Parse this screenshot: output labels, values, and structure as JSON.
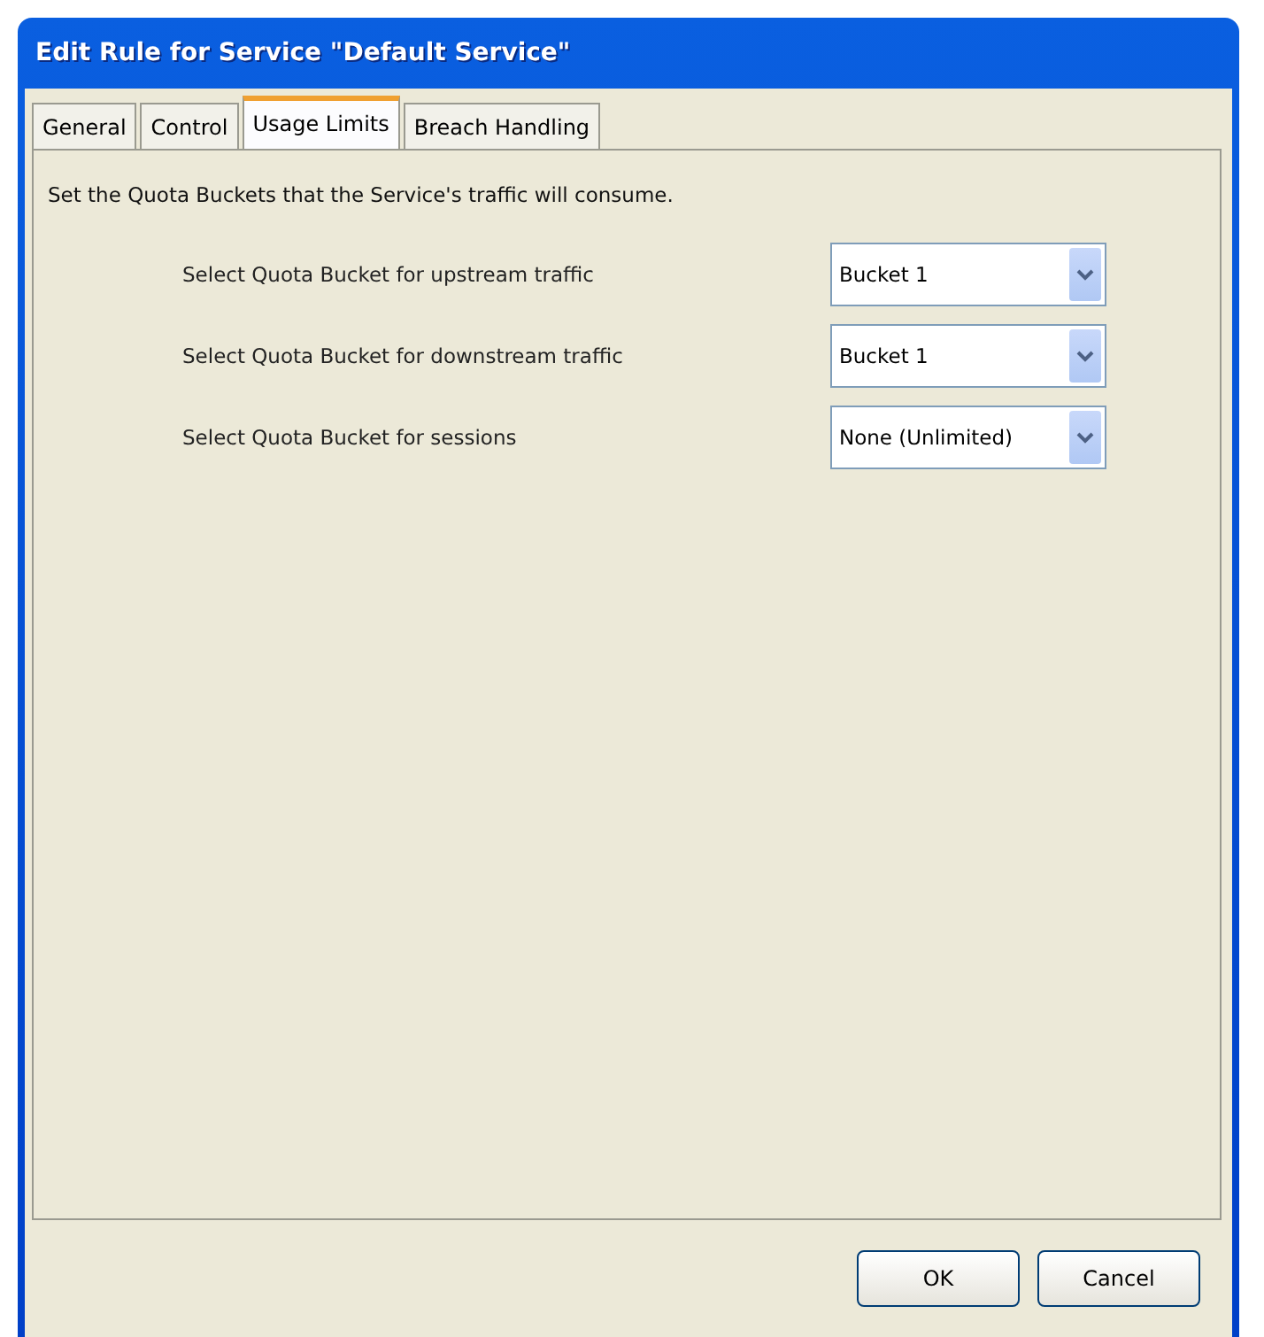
{
  "window": {
    "title": "Edit Rule for Service \"Default Service\""
  },
  "tabs": [
    {
      "label": "General",
      "selected": false
    },
    {
      "label": "Control",
      "selected": false
    },
    {
      "label": "Usage Limits",
      "selected": true
    },
    {
      "label": "Breach Handling",
      "selected": false
    }
  ],
  "description": "Set the Quota Buckets that the Service's traffic will consume.",
  "fields": [
    {
      "label": "Select Quota Bucket for upstream traffic",
      "value": "Bucket 1"
    },
    {
      "label": "Select Quota Bucket for downstream traffic",
      "value": "Bucket 1"
    },
    {
      "label": "Select Quota Bucket for sessions",
      "value": "None (Unlimited)"
    }
  ],
  "buttons": [
    "OK",
    "Cancel"
  ]
}
